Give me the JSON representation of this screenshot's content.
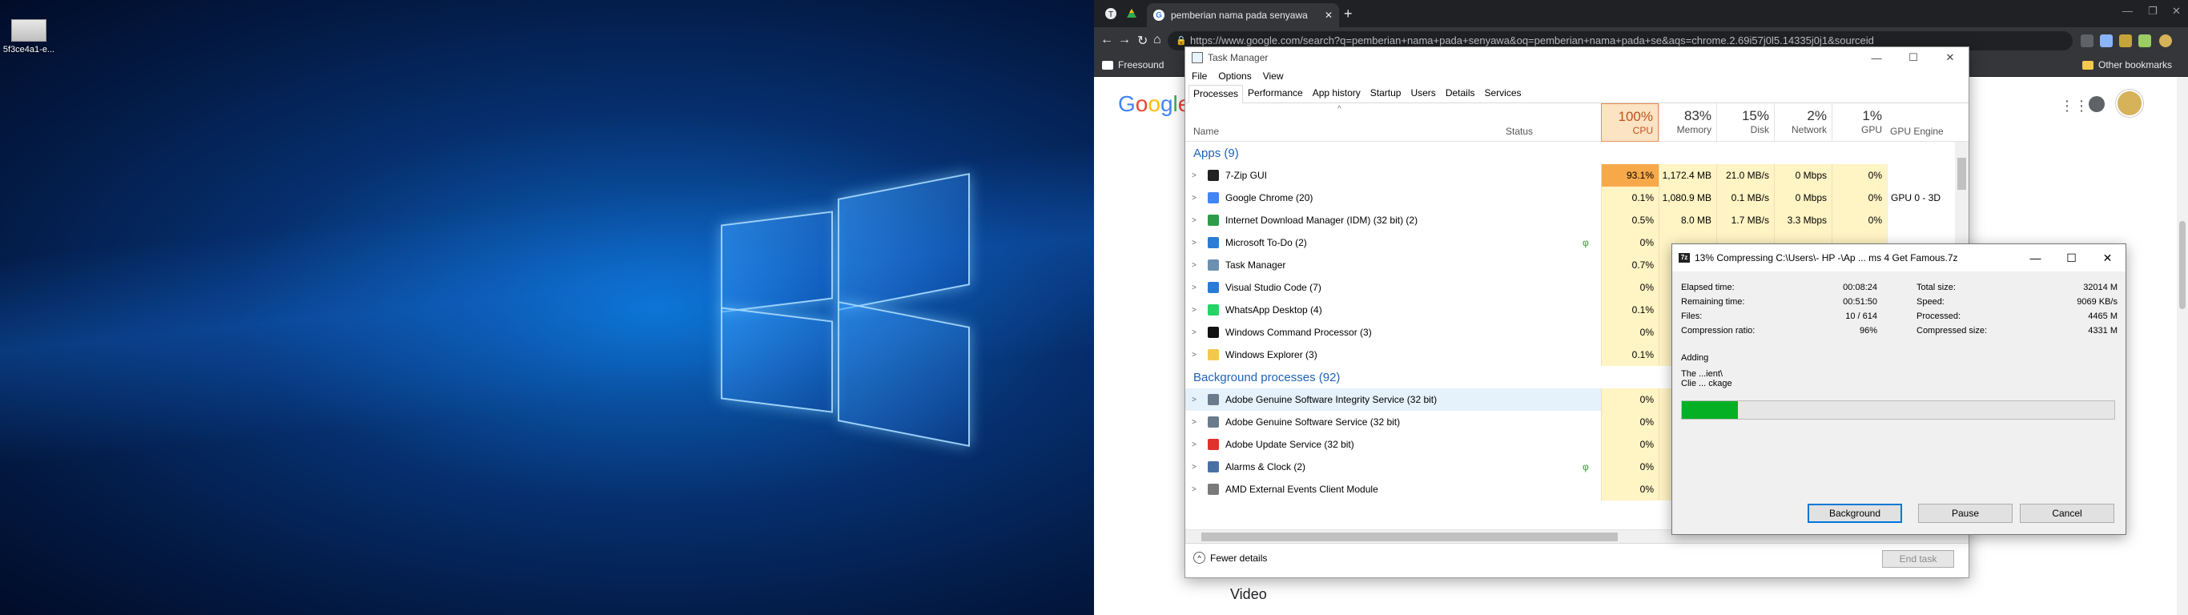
{
  "desktop": {
    "file_label": "5f3ce4a1-e..."
  },
  "chrome": {
    "tab_title": "pemberian nama pada senyawa",
    "url": "https://www.google.com/search?q=pemberian+nama+pada+senyawa&oq=pemberian+nama+pada+se&aqs=chrome.2.69i57j0l5.14335j0j1&sourceid",
    "bookmarks": [
      "Freesound",
      "Other bookmarks"
    ],
    "icons": {
      "back": "←",
      "forward": "→",
      "reload": "↻",
      "home": "⌂",
      "new_tab": "+",
      "close": "✕",
      "lock": "🔒"
    }
  },
  "google": {
    "logo": [
      "G",
      "o",
      "o",
      "g",
      "l",
      "e"
    ],
    "video_label": "Video"
  },
  "task_manager": {
    "title": "Task Manager",
    "menu": [
      "File",
      "Options",
      "View"
    ],
    "tabs": [
      "Processes",
      "Performance",
      "App history",
      "Startup",
      "Users",
      "Details",
      "Services"
    ],
    "headers": {
      "name": "Name",
      "status": "Status",
      "cpu_pct": "100%",
      "cpu": "CPU",
      "mem_pct": "83%",
      "mem": "Memory",
      "disk_pct": "15%",
      "disk": "Disk",
      "net_pct": "2%",
      "net": "Network",
      "gpu_pct": "1%",
      "gpu": "GPU",
      "gpu_engine": "GPU Engine"
    },
    "apps_group": "Apps (9)",
    "apps": [
      {
        "name": "7-Zip GUI",
        "cpu": "93.1%",
        "mem": "1,172.4 MB",
        "disk": "21.0 MB/s",
        "net": "0 Mbps",
        "gpu": "0%",
        "engine": "",
        "leaf": ""
      },
      {
        "name": "Google Chrome (20)",
        "cpu": "0.1%",
        "mem": "1,080.9 MB",
        "disk": "0.1 MB/s",
        "net": "0 Mbps",
        "gpu": "0%",
        "engine": "GPU 0 - 3D",
        "leaf": ""
      },
      {
        "name": "Internet Download Manager (IDM) (32 bit) (2)",
        "cpu": "0.5%",
        "mem": "8.0 MB",
        "disk": "1.7 MB/s",
        "net": "3.3 Mbps",
        "gpu": "0%",
        "engine": "",
        "leaf": ""
      },
      {
        "name": "Microsoft To-Do (2)",
        "cpu": "0%",
        "mem": "",
        "disk": "",
        "net": "",
        "gpu": "",
        "engine": "",
        "leaf": "φ"
      },
      {
        "name": "Task Manager",
        "cpu": "0.7%",
        "mem": "",
        "disk": "",
        "net": "",
        "gpu": "",
        "engine": "",
        "leaf": ""
      },
      {
        "name": "Visual Studio Code (7)",
        "cpu": "0%",
        "mem": "",
        "disk": "",
        "net": "",
        "gpu": "",
        "engine": "",
        "leaf": ""
      },
      {
        "name": "WhatsApp Desktop (4)",
        "cpu": "0.1%",
        "mem": "",
        "disk": "",
        "net": "",
        "gpu": "",
        "engine": "",
        "leaf": ""
      },
      {
        "name": "Windows Command Processor (3)",
        "cpu": "0%",
        "mem": "",
        "disk": "",
        "net": "",
        "gpu": "",
        "engine": "",
        "leaf": ""
      },
      {
        "name": "Windows Explorer (3)",
        "cpu": "0.1%",
        "mem": "",
        "disk": "",
        "net": "",
        "gpu": "",
        "engine": "",
        "leaf": ""
      }
    ],
    "bg_group": "Background processes (92)",
    "background": [
      {
        "name": "Adobe Genuine Software Integrity Service (32 bit)",
        "cpu": "0%",
        "mem": "",
        "disk": "",
        "net": "",
        "gpu": "",
        "engine": "",
        "leaf": ""
      },
      {
        "name": "Adobe Genuine Software Service (32 bit)",
        "cpu": "0%",
        "mem": "",
        "disk": "",
        "net": "",
        "gpu": "",
        "engine": "",
        "leaf": ""
      },
      {
        "name": "Adobe Update Service (32 bit)",
        "cpu": "0%",
        "mem": "",
        "disk": "",
        "net": "",
        "gpu": "",
        "engine": "",
        "leaf": ""
      },
      {
        "name": "Alarms & Clock (2)",
        "cpu": "0%",
        "mem": "",
        "disk": "",
        "net": "",
        "gpu": "",
        "engine": "",
        "leaf": "φ"
      },
      {
        "name": "AMD External Events Client Module",
        "cpu": "0%",
        "mem": "",
        "disk": "",
        "net": "",
        "gpu": "",
        "engine": "",
        "leaf": ""
      }
    ],
    "fewer_details": "Fewer details",
    "end_task": "End task"
  },
  "sevenzip": {
    "title": "13% Compressing C:\\Users\\- HP -\\Ap ... ms 4 Get Famous.7z",
    "progress": 0.13,
    "stats_left": [
      {
        "label": "Elapsed time:",
        "value": "00:08:24"
      },
      {
        "label": "Remaining time:",
        "value": "00:51:50"
      },
      {
        "label": "Files:",
        "value": "10 / 614"
      },
      {
        "label": "Compression ratio:",
        "value": "96%"
      }
    ],
    "stats_right": [
      {
        "label": "Total size:",
        "value": "32014 M"
      },
      {
        "label": "Speed:",
        "value": "9069 KB/s"
      },
      {
        "label": "Processed:",
        "value": "4465 M"
      },
      {
        "label": "Compressed size:",
        "value": "4331 M"
      }
    ],
    "adding": "Adding",
    "file_line1": "The ...ient\\",
    "file_line2": "Clie ... ckage",
    "buttons": {
      "background": "Background",
      "pause": "Pause",
      "cancel": "Cancel"
    }
  },
  "colors": {
    "cpu_hot": "#f7a94a",
    "cell_warm": "#fff4c4",
    "progress_fill": "#06b025",
    "chrome_dark": "#202124"
  }
}
